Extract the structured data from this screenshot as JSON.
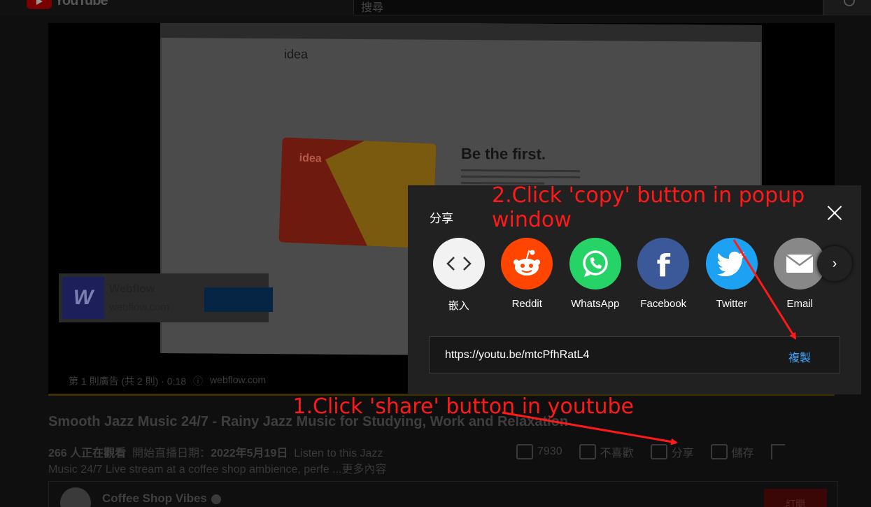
{
  "header": {
    "logo_text": "YouTube",
    "search_placeholder": "搜尋"
  },
  "player": {
    "screen": {
      "site_logo": "idea",
      "card_text": "idea",
      "headline": "Be the first."
    },
    "ad": {
      "logo_letter": "W",
      "name": "Webflow",
      "domain": "webflow.com",
      "info": "第 1 則廣告 (共 2 則) · 0:18",
      "info_link": "webflow.com"
    }
  },
  "video": {
    "title": "Smooth Jazz Music 24/7 - Rainy Jazz Music for Studying, Work and Relaxation",
    "watching": "266 人正在觀看",
    "started_label": "開始直播日期：",
    "started_date": "2022年5月19日",
    "desc_line1": "Listen to this Jazz",
    "desc_line2": "Music 24/7 Live stream at a coffee shop ambience, perfe",
    "more": "...更多內容",
    "likes": "7930",
    "dislike_label": "不喜歡",
    "share_label": "分享",
    "save_label": "儲存"
  },
  "channel": {
    "name": "Coffee Shop Vibes",
    "subscribe_label": "訂閱"
  },
  "share_dialog": {
    "title": "分享",
    "targets": [
      {
        "label": "嵌入",
        "icon": "embed-icon",
        "color": "#f2f2f2"
      },
      {
        "label": "Reddit",
        "icon": "reddit-icon",
        "color": "#ff4500"
      },
      {
        "label": "WhatsApp",
        "icon": "whatsapp-icon",
        "color": "#25d366"
      },
      {
        "label": "Facebook",
        "icon": "facebook-icon",
        "color": "#3b5998"
      },
      {
        "label": "Twitter",
        "icon": "twitter-icon",
        "color": "#1da1f2"
      },
      {
        "label": "Email",
        "icon": "email-icon",
        "color": "#888888"
      }
    ],
    "url": "https://youtu.be/mtcPfhRatL4",
    "copy_label": "複製"
  },
  "annotations": {
    "step1": "1.Click 'share' button in youtube",
    "step2_line1": "2.Click 'copy' button in popup",
    "step2_line2": "window",
    "color": "#ff1a1a"
  }
}
